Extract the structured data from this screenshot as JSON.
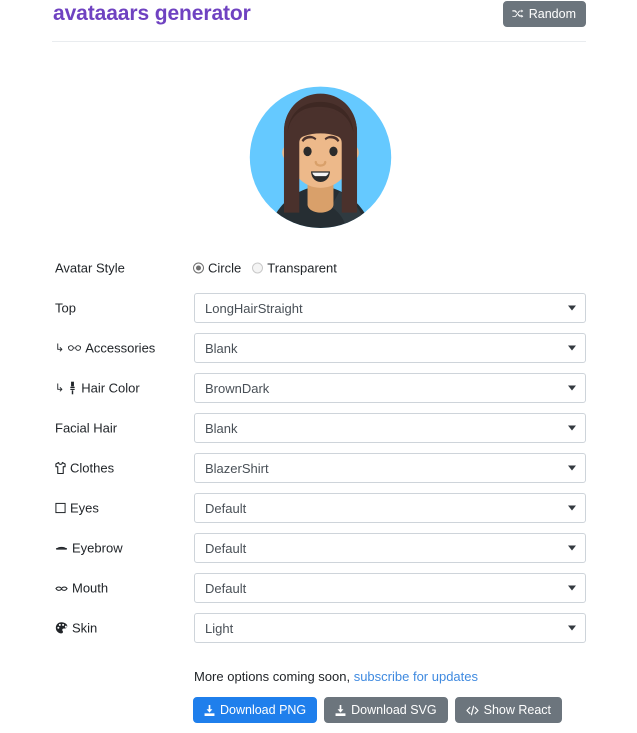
{
  "header": {
    "title": "avataaars generator",
    "random_label": "Random",
    "random_icon": "shuffle-icon"
  },
  "avatar": {
    "style": "Circle",
    "background_color": "#65C9FF",
    "skin_color": "#EDB98A",
    "hair_color": "#4A312C",
    "clothes_color": "#262E33",
    "clothes_accent": "#3A4B53"
  },
  "form": {
    "rows": [
      {
        "label": "Avatar Style",
        "icon": null,
        "nested": false,
        "type": "radio",
        "options": [
          "Circle",
          "Transparent"
        ],
        "value": "Circle"
      },
      {
        "label": "Top",
        "icon": null,
        "nested": false,
        "type": "select",
        "value": "LongHairStraight"
      },
      {
        "label": "Accessories",
        "icon": "glasses-icon",
        "nested": true,
        "type": "select",
        "value": "Blank"
      },
      {
        "label": "Hair Color",
        "icon": "hair-brush-icon",
        "nested": true,
        "type": "select",
        "value": "BrownDark"
      },
      {
        "label": "Facial Hair",
        "icon": null,
        "nested": false,
        "type": "select",
        "value": "Blank"
      },
      {
        "label": "Clothes",
        "icon": "tshirt-icon",
        "nested": false,
        "type": "select",
        "value": "BlazerShirt"
      },
      {
        "label": "Eyes",
        "icon": "eye-icon",
        "nested": false,
        "type": "select",
        "value": "Default"
      },
      {
        "label": "Eyebrow",
        "icon": "eyebrow-icon",
        "nested": false,
        "type": "select",
        "value": "Default"
      },
      {
        "label": "Mouth",
        "icon": "mouth-icon",
        "nested": false,
        "type": "select",
        "value": "Default"
      },
      {
        "label": "Skin",
        "icon": "palette-icon",
        "nested": false,
        "type": "select",
        "value": "Light"
      }
    ]
  },
  "footer": {
    "more_text": "More options coming soon, ",
    "subscribe_link": "subscribe for updates",
    "buttons": [
      {
        "label": "Download PNG",
        "icon": "download-icon",
        "style": "primary"
      },
      {
        "label": "Download SVG",
        "icon": "download-icon",
        "style": "secondary"
      },
      {
        "label": "Show React",
        "icon": "code-icon",
        "style": "secondary"
      }
    ]
  },
  "colors": {
    "title": "#6f42c1",
    "primary": "#1f7fec",
    "secondary": "#6c757d",
    "link": "#3f8ae0"
  }
}
